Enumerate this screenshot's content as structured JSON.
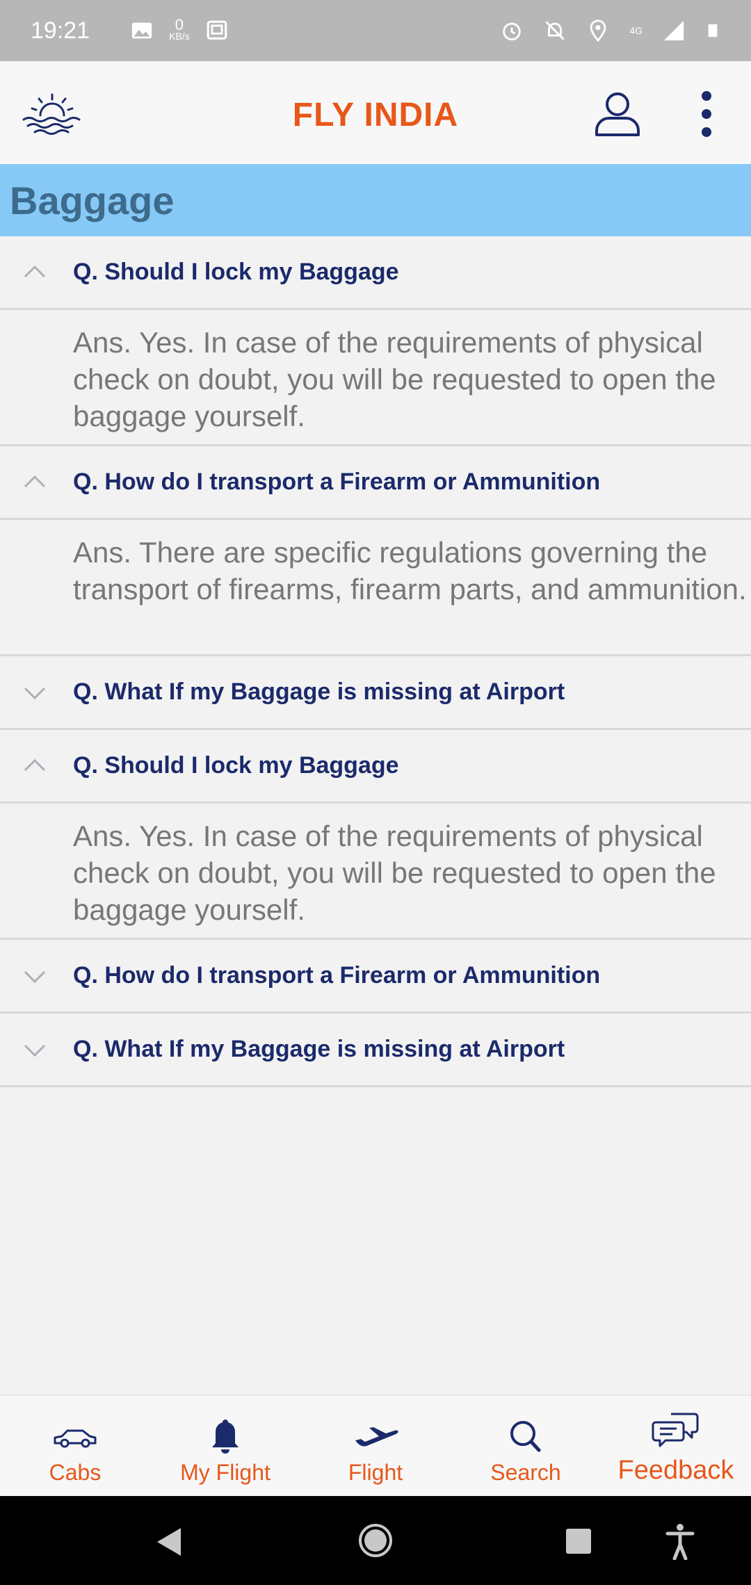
{
  "status_bar": {
    "time": "19:21",
    "net_speed_value": "0",
    "net_speed_unit": "KB/s",
    "network": "4G",
    "icons": [
      "image-icon",
      "vault-icon",
      "alarm-icon",
      "mute-icon",
      "location-icon",
      "signal-icon",
      "battery-icon"
    ]
  },
  "app_bar": {
    "title": "FLY INDIA",
    "logo_icon": "sunset-sea-icon",
    "profile_icon": "profile-icon",
    "menu_icon": "more-vert-icon"
  },
  "section": {
    "title": "Baggage"
  },
  "faq": {
    "items": [
      {
        "question": "Q. Should I lock my Baggage",
        "expanded": true,
        "answer": "Ans. Yes. In case of the requirements of physical check on doubt, you will be requested to open the baggage yourself."
      },
      {
        "question": "Q. How do I transport a Firearm or Ammunition",
        "expanded": true,
        "answer": "Ans. There are specific regulations governing the transport of firearms, firearm parts, and ammunition."
      },
      {
        "question": "Q. What If my Baggage is missing at Airport",
        "expanded": false
      },
      {
        "question": "Q. Should I lock my Baggage",
        "expanded": true,
        "answer": "Ans. Yes. In case of the requirements of physical check on doubt, you will be requested to open the baggage yourself."
      },
      {
        "question": "Q. How do I transport a Firearm or Ammunition",
        "expanded": false
      },
      {
        "question": "Q. What If my Baggage is missing at Airport",
        "expanded": false
      }
    ]
  },
  "bottom_nav": {
    "items": [
      {
        "label": "Cabs",
        "icon": "car-icon"
      },
      {
        "label": "My Flight",
        "icon": "bell-icon"
      },
      {
        "label": "Flight",
        "icon": "airplane-icon"
      },
      {
        "label": "Search",
        "icon": "search-icon"
      },
      {
        "label": "Feedback",
        "icon": "feedback-icon"
      }
    ]
  },
  "colors": {
    "accent": "#e8571a",
    "question_text": "#1b2a6b",
    "section_header_bg": "#87c9f6",
    "nav_icon": "#1b2a6b"
  }
}
